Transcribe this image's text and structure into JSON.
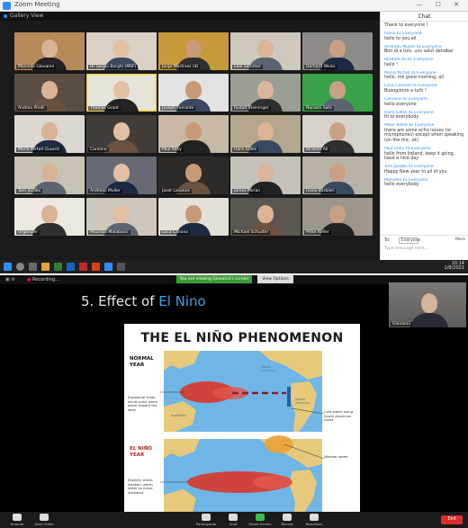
{
  "top_window": {
    "title": "Zoom Meeting",
    "subtitle": "Gallery View",
    "window_controls": "— ☐ ✕"
  },
  "gallery": {
    "participants": [
      "Marcello Giovanni",
      "Dr Sergio Borghi (MSF)",
      "Jorge Martinez (it)",
      "Elke Sommer",
      "Gerhard Weiss",
      "Andrea Pirelli",
      "Thomas Grant",
      "Joseph Ferrante",
      "Rudolf Steininger",
      "Nanami Sato",
      "Maria Mirtell (Guest)",
      "Caroline",
      "Paul Riley",
      "Hans Gilles",
      "Ibrahim Ali",
      "Tom Jacobs",
      "Andreas Muller",
      "Joost Lasance",
      "James Moran",
      "Ivano Barbieri",
      "Organizer",
      "Maurizio Malabassi",
      "Luca Canova",
      "Michael Schuster",
      "Peter Keller"
    ]
  },
  "chat": {
    "header": "Chat",
    "messages": [
      {
        "from": "",
        "text": "Thank to everyone !"
      },
      {
        "from": "Ivano to Everyone",
        "text": "hello to you all"
      },
      {
        "from": "Andreas Muller to Everyone",
        "text": "Bon di a tots, uns salut dendbai"
      },
      {
        "from": "Ibrahim Ali to Everyone",
        "text": "hello !"
      },
      {
        "from": "Maria Mirtell to Everyone",
        "text": "hello, me good morning, all"
      },
      {
        "from": "Luca Canova to Everyone",
        "text": "Buongiorno a tutti !"
      },
      {
        "from": "Caroline to Everyone",
        "text": "hello everyone"
      },
      {
        "from": "Hans Gilles to Everyone",
        "text": "Hi to everybody"
      },
      {
        "from": "Peter Keller to Everyone",
        "text": "there are some echo issues (or microphones) except when speaking (on the mic, ok)"
      },
      {
        "from": "Paul Riley to Everyone",
        "text": "hello from Ireland, keep it going, have a nice day"
      },
      {
        "from": "Tom Jacobs to Everyone",
        "text": "Happy New year to all of you"
      },
      {
        "from": "Marcello to Everyone",
        "text": "hello everybody"
      }
    ],
    "to_label": "To:",
    "to_value": "Everyone",
    "more_label": "More",
    "input_placeholder": "Type message here..."
  },
  "taskbar": {
    "time": "10:14",
    "date": "1/8/2021"
  },
  "bottom_window": {
    "status": "Recording...",
    "share_banner": "You are viewing Giovanni's screen",
    "view_options": "View Options",
    "speaker_name": "Giovanni"
  },
  "slide": {
    "title_prefix": "5. Effect of ",
    "title_highlight": "El Nino",
    "heading": "THE EL NIÑO PHENOMENON",
    "normal_label": "NORMAL YEAR",
    "elnino_label": "EL NIÑO YEAR",
    "ann_normal_west": "Equatorial trade winds push warm water toward the west",
    "ann_normal_east": "Cold water along South American coast",
    "ann_elnino_west": "Easterly winds weaken; warm water to move eastward",
    "ann_elnino_east": "Warmer water",
    "map_na": "North America",
    "map_sa": "South America",
    "map_au": "Australia"
  },
  "toolbar": {
    "items": [
      "Unmute",
      "Start Video",
      "Participants",
      "Chat",
      "Share Screen",
      "Record",
      "Reactions"
    ],
    "end": "End"
  },
  "colors": {
    "accent": "#2d8cff",
    "share_banner": "#3c9c3a",
    "end_button": "#e02b2b",
    "slide_highlight": "#3aa0e6",
    "warm_water": "#d9362a",
    "ocean": "#6fb6e6"
  }
}
